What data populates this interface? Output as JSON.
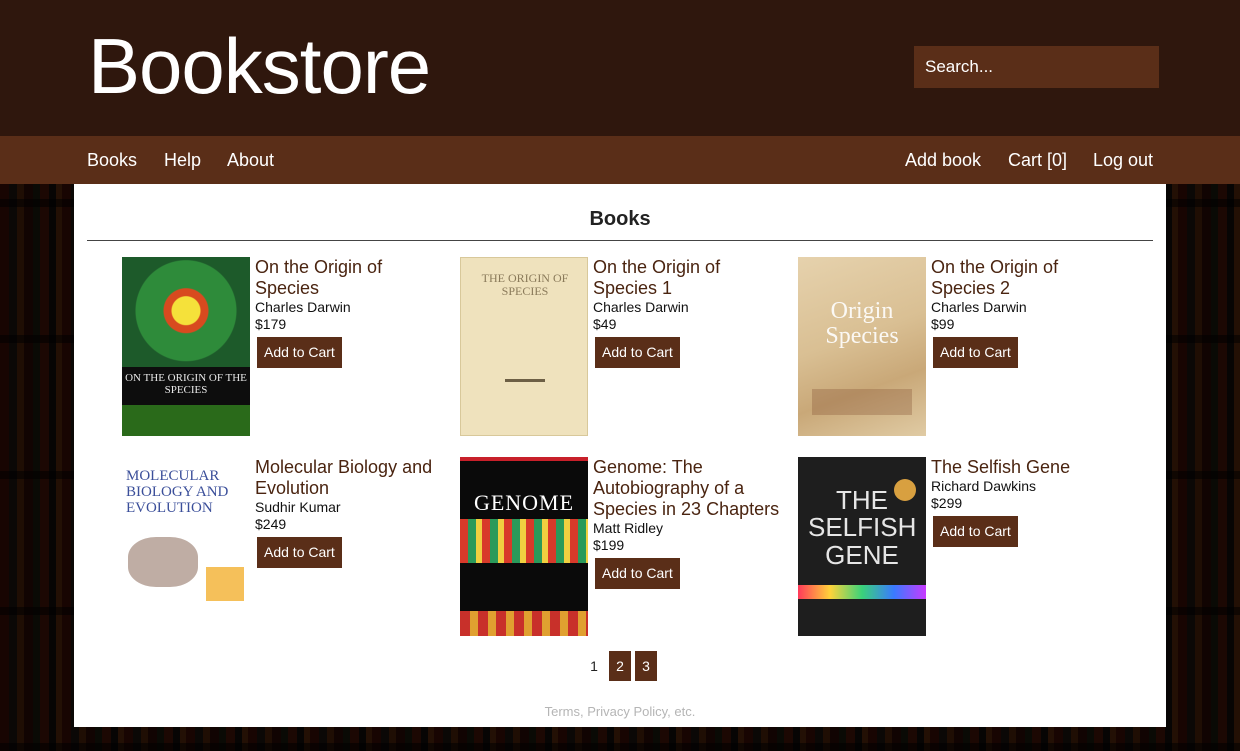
{
  "header": {
    "brand": "Bookstore",
    "search_placeholder": "Search..."
  },
  "nav": {
    "left": [
      "Books",
      "Help",
      "About"
    ],
    "right": [
      "Add book",
      "Cart [0]",
      "Log out"
    ]
  },
  "main": {
    "title": "Books",
    "add_to_cart_label": "Add to Cart",
    "books": [
      {
        "title": "On the Origin of Species",
        "author": "Charles Darwin",
        "price": "$179",
        "cover_text": "ON THE ORIGIN OF THE SPECIES"
      },
      {
        "title": "On the Origin of Species 1",
        "author": "Charles Darwin",
        "price": "$49",
        "cover_text": "THE ORIGIN OF SPECIES"
      },
      {
        "title": "On the Origin of Species 2",
        "author": "Charles Darwin",
        "price": "$99",
        "cover_text": "Origin Species"
      },
      {
        "title": "Molecular Biology and Evolution",
        "author": "Sudhir Kumar",
        "price": "$249",
        "cover_text": "MOLECULAR BIOLOGY AND EVOLUTION"
      },
      {
        "title": "Genome: The Autobiography of a Species in 23 Chapters",
        "author": "Matt Ridley",
        "price": "$199",
        "cover_text": "GENOME"
      },
      {
        "title": "The Selfish Gene",
        "author": "Richard Dawkins",
        "price": "$299",
        "cover_text": "THE SELFISH GENE"
      }
    ],
    "pagination": {
      "current": "1",
      "pages": [
        "2",
        "3"
      ]
    }
  },
  "footer": {
    "link_text": "Terms, Privacy Policy, etc."
  },
  "colors": {
    "header_bg": "#2f170d",
    "nav_bg": "#5a2e18",
    "accent": "#5a2e18"
  }
}
